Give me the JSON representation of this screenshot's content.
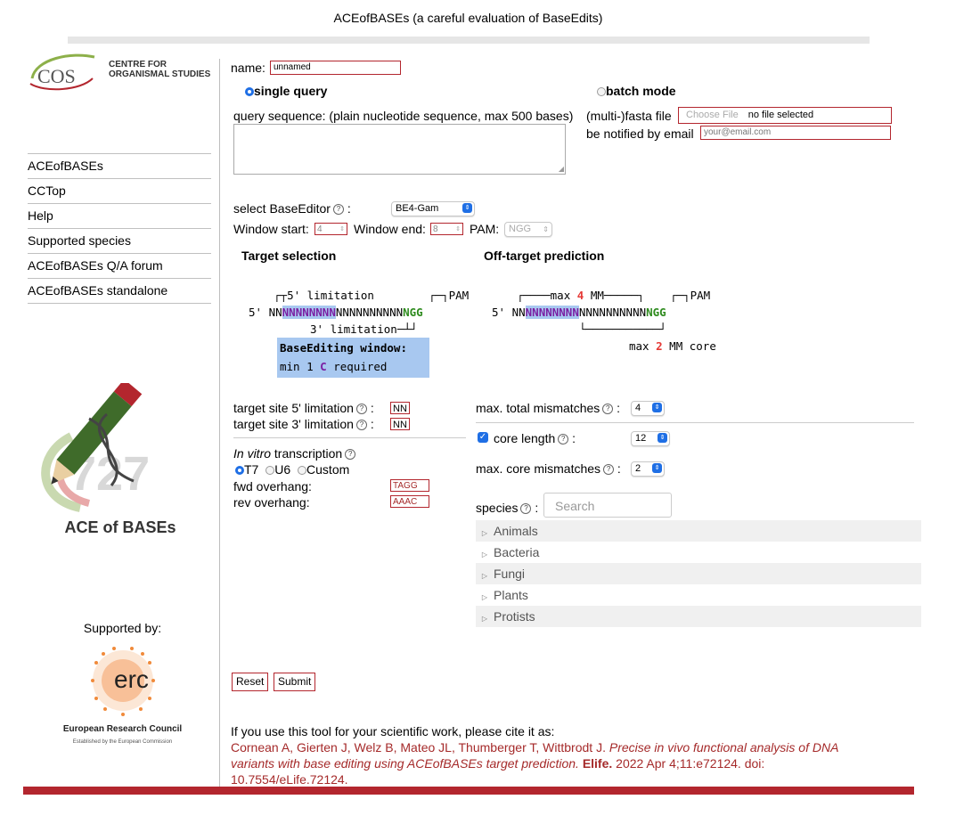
{
  "page": {
    "title": "ACEofBASEs (a careful evaluation of BaseEdits)"
  },
  "sidebar": {
    "logo_text_line1": "CENTRE FOR",
    "logo_text_line2": "ORGANISMAL STUDIES",
    "logo_mark": "COS",
    "items": [
      {
        "label": "ACEofBASEs"
      },
      {
        "label": "CCTop"
      },
      {
        "label": "Help"
      },
      {
        "label": "Supported species"
      },
      {
        "label": "ACEofBASEs Q/A forum"
      },
      {
        "label": "ACEofBASEs standalone"
      }
    ],
    "ace_logo_text": "ACE of BASEs",
    "supported_by": "Supported by:",
    "erc_mark": "erc",
    "erc_name": "European Research Council",
    "erc_sub": "Established by the European Commission"
  },
  "form": {
    "name_label": "name:",
    "name_value": "unnamed",
    "mode_single": "single query",
    "mode_batch": "batch mode",
    "query_label": "query sequence: (plain nucleotide sequence, max 500 bases)",
    "fasta_label": "(multi-)fasta file",
    "choose_file": "Choose File",
    "no_file": "no file selected",
    "notify_label": "be notified by email",
    "email_placeholder": "your@email.com",
    "select_editor_label": "select BaseEditor",
    "editor_value": "BE4-Gam",
    "window_start_label": "Window start:",
    "window_start_value": "4",
    "window_end_label": "Window end:",
    "window_end_value": "8",
    "pam_label": "PAM:",
    "pam_value": "NGG"
  },
  "target_selection": {
    "heading": "Target selection",
    "limit5": "5' limitation",
    "pam": "PAM",
    "seq_prefix": "5' NN",
    "seq_window": "NNNNNNNN",
    "seq_rest": "NNNNNNNNNN",
    "seq_pam": "NGG",
    "limit3": "3' limitation",
    "window_title": "BaseEditing window:",
    "window_req_pre": "min 1",
    "window_req_c": "C",
    "window_req_post": "required"
  },
  "offtarget": {
    "heading": "Off-target prediction",
    "max_label": "max",
    "max_mm": "4",
    "mm_label": "MM",
    "pam": "PAM",
    "seq_prefix": "5' NN",
    "seq_window": "NNNNNNNN",
    "seq_rest": "NNNNNNNNNN",
    "seq_pam": "NGG",
    "core_max": "2",
    "core_label": "MM core"
  },
  "limits": {
    "site5_label": "target site 5' limitation",
    "site5_value": "NN",
    "site3_label": "target site 3' limitation",
    "site3_value": "NN",
    "invitro_em": "In vitro",
    "invitro_rest": "transcription",
    "t7": "T7",
    "u6": "U6",
    "custom": "Custom",
    "fwd_label": "fwd overhang:",
    "fwd_value": "TAGG",
    "rev_label": "rev overhang:",
    "rev_value": "AAAC"
  },
  "mismatch": {
    "total_label": "max. total mismatches",
    "total_value": "4",
    "core_length_label": "core length",
    "core_length_value": "12",
    "core_mm_label": "max. core mismatches",
    "core_mm_value": "2"
  },
  "species": {
    "label": "species",
    "search_placeholder": "Search",
    "groups": [
      "Animals",
      "Bacteria",
      "Fungi",
      "Plants",
      "Protists"
    ]
  },
  "buttons": {
    "reset": "Reset",
    "submit": "Submit"
  },
  "citation": {
    "intro": "If you use this tool for your scientific work, please cite it as:",
    "authors": "Cornean A, Gierten J, Welz B, Mateo JL, Thumberger T, Wittbrodt J.",
    "title": "Precise in vivo functional analysis of DNA variants with base editing using ACEofBASEs target prediction.",
    "journal": "Elife.",
    "rest": "2022 Apr 4;11:e72124. doi: 10.7554/eLife.72124."
  },
  "colors": {
    "accent_red": "#b3262e",
    "link_red": "#a52a2a",
    "blue": "#1f6fe5"
  }
}
